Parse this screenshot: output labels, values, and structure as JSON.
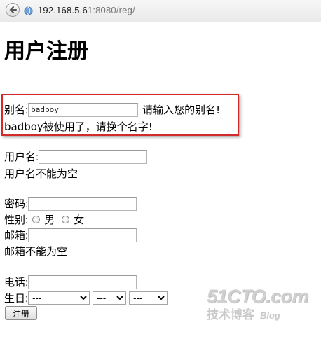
{
  "browser": {
    "url_host": "192.168.5.61",
    "url_path": ":8080/reg/"
  },
  "page": {
    "title": "用户注册"
  },
  "form": {
    "alias_label": "别名:",
    "alias_value": "badboy",
    "alias_hint": "请输入您的别名!",
    "alias_error": "badboy被使用了，请换个名字!",
    "username_label": "用户名:",
    "username_value": "",
    "username_error": "用户名不能为空",
    "password_label": "密码:",
    "password_value": "",
    "gender_label": "性别:",
    "gender_options": [
      "男",
      "女"
    ],
    "email_label": "邮箱:",
    "email_value": "",
    "email_error": "邮箱不能为空",
    "phone_label": "电话:",
    "phone_value": "",
    "birthday_label": "生日:",
    "birthday_year": "---",
    "birthday_month": "---",
    "birthday_day": "---",
    "submit_label": "注册"
  },
  "watermark": {
    "line1": "51CTO.com",
    "line2": "技术博客",
    "line3": "Blog"
  },
  "colors": {
    "highlight_border": "#d42a2a"
  }
}
